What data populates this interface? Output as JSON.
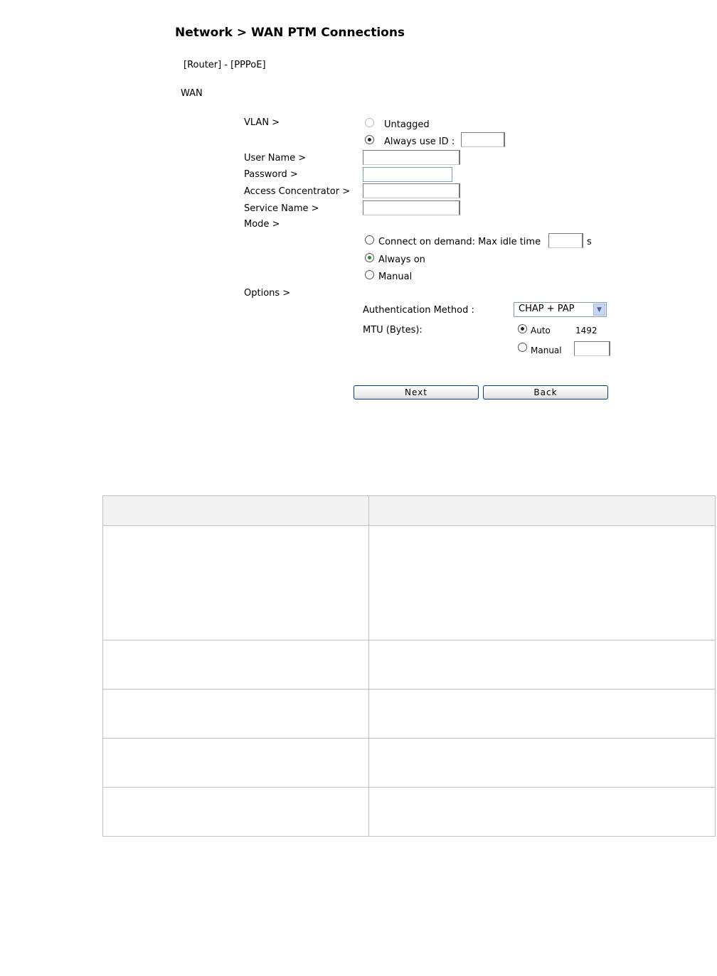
{
  "page": {
    "title": "Network > WAN PTM Connections",
    "breadcrumb": "[Router] - [PPPoE]",
    "section": "WAN"
  },
  "form": {
    "vlan": {
      "label": "VLAN >",
      "untagged_label": "Untagged",
      "always_label": "Always use ID :",
      "id_value": "",
      "selected": "always"
    },
    "user_name": {
      "label": "User Name >",
      "value": ""
    },
    "password": {
      "label": "Password >",
      "value": ""
    },
    "access_concentrator": {
      "label": "Access Concentrator >",
      "value": ""
    },
    "service_name": {
      "label": "Service Name >",
      "value": ""
    },
    "mode": {
      "label": "Mode >",
      "connect_on_demand_label": "Connect on demand: Max idle time",
      "idle_value": "",
      "idle_unit": "s",
      "always_on_label": "Always on",
      "manual_label": "Manual",
      "selected": "always_on"
    },
    "options": {
      "label": "Options >",
      "auth_label": "Authentication Method :",
      "auth_value": "CHAP + PAP",
      "mtu_label": "MTU (Bytes):",
      "mtu_auto_label": "Auto",
      "mtu_auto_value": "1492",
      "mtu_manual_label": "Manual",
      "mtu_manual_value": "",
      "mtu_selected": "auto"
    }
  },
  "buttons": {
    "next": "Next",
    "back": "Back"
  },
  "table": {
    "headers": [
      "",
      ""
    ],
    "rows": [
      [
        "",
        ""
      ],
      [
        "",
        ""
      ],
      [
        "",
        ""
      ],
      [
        "",
        ""
      ],
      [
        "",
        ""
      ]
    ]
  }
}
